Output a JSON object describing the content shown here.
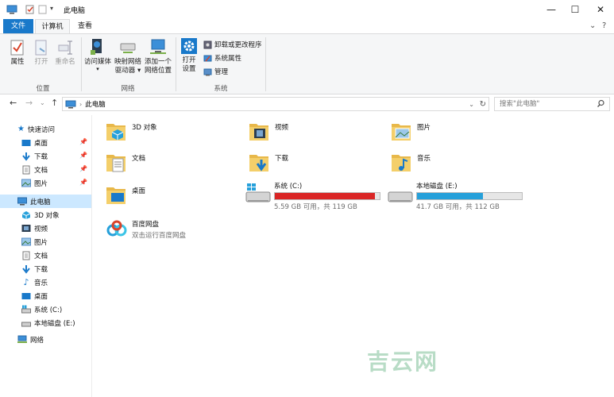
{
  "window": {
    "title": "此电脑"
  },
  "ribbon_tabs": {
    "file": "文件",
    "computer": "计算机",
    "view": "查看"
  },
  "ribbon": {
    "location_group": {
      "label": "位置",
      "properties": "属性",
      "open": "打开",
      "rename": "重命名"
    },
    "network_group": {
      "label": "网络",
      "access_media": "访问媒体",
      "map_drive_line1": "映射网络",
      "map_drive_line2": "驱动器",
      "add_location_line1": "添加一个",
      "add_location_line2": "网络位置"
    },
    "system_group": {
      "label": "系统",
      "open_settings_line1": "打开",
      "open_settings_line2": "设置",
      "uninstall": "卸载或更改程序",
      "system_properties": "系统属性",
      "manage": "管理"
    }
  },
  "address": {
    "path": "此电脑",
    "search_placeholder": "搜索\"此电脑\""
  },
  "sidebar": {
    "quick_access": "快速访问",
    "quick_items": [
      "桌面",
      "下载",
      "文档",
      "图片"
    ],
    "this_pc": "此电脑",
    "pc_items": [
      "3D 对象",
      "视频",
      "图片",
      "文档",
      "下载",
      "音乐",
      "桌面",
      "系统 (C:)",
      "本地磁盘 (E:)"
    ],
    "network": "网络"
  },
  "folders": [
    "3D 对象",
    "视频",
    "图片",
    "文档",
    "下载",
    "音乐",
    "桌面"
  ],
  "drives": [
    {
      "name": "系统 (C:)",
      "detail": "5.59 GB 可用，共 119 GB",
      "used_fraction": 0.953,
      "color": "#da2626"
    },
    {
      "name": "本地磁盘 (E:)",
      "detail": "41.7 GB 可用，共 112 GB",
      "used_fraction": 0.628,
      "color": "#26a0da"
    }
  ],
  "baidu": {
    "name": "百度网盘",
    "sub": "双击运行百度网盘"
  },
  "watermark": "吉云网"
}
